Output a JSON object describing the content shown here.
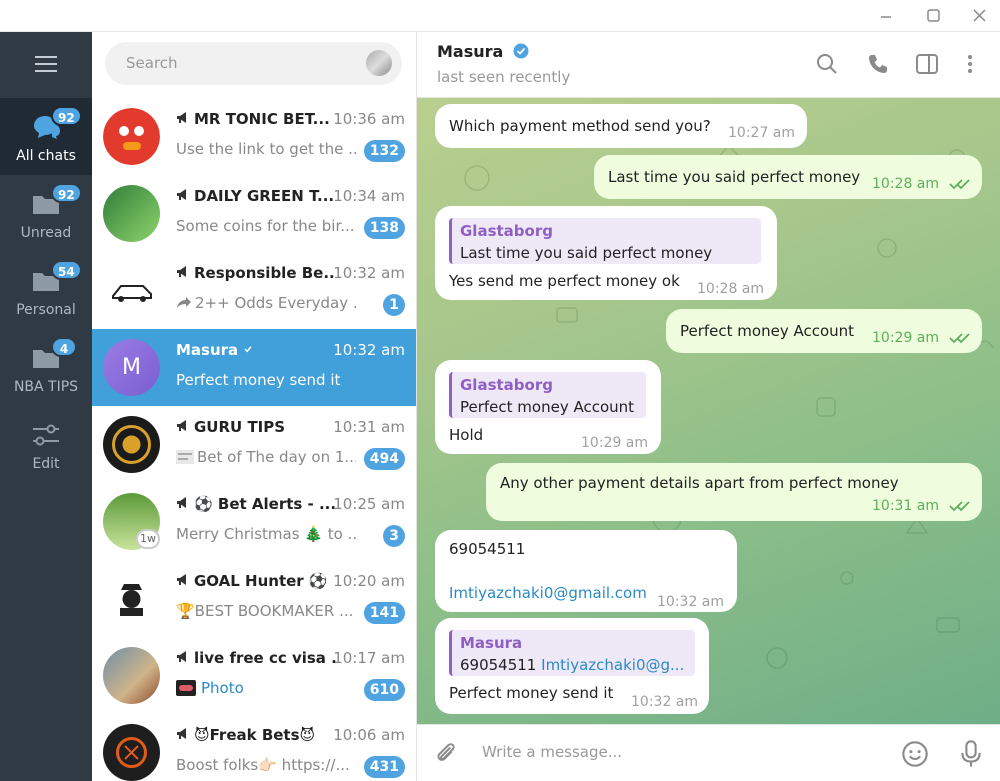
{
  "window": {
    "minimize": "—",
    "maximize": "☐",
    "close": "✕"
  },
  "folders": [
    {
      "label": "All chats",
      "badge": "92",
      "icon": "chats-icon",
      "active": true
    },
    {
      "label": "Unread",
      "badge": "92",
      "icon": "folder-icon"
    },
    {
      "label": "Personal",
      "badge": "54",
      "icon": "folder-icon"
    },
    {
      "label": "NBA TIPS",
      "badge": "4",
      "icon": "folder-icon"
    },
    {
      "label": "Edit",
      "icon": "edit-sliders-icon"
    }
  ],
  "search": {
    "placeholder": "Search"
  },
  "chats": [
    {
      "name": "MR TONIC BET...",
      "time": "10:36 am",
      "preview": "Use the link to get the ...",
      "badge": "132",
      "channel": true
    },
    {
      "name": "DAILY GREEN T...",
      "time": "10:34 am",
      "preview": "Some coins for the bir...",
      "badge": "138",
      "channel": true
    },
    {
      "name": "Responsible Be...",
      "time": "10:32 am",
      "preview": "2++ Odds  Everyday ...",
      "badge": "1",
      "channel": true
    },
    {
      "name": "Masura",
      "time": "10:32 am",
      "preview": "Perfect money send it",
      "initial": "M",
      "verified": true,
      "active": true
    },
    {
      "name": "GURU TIPS",
      "time": "10:31 am",
      "preview": "Bet of The day on 1...",
      "badge": "494",
      "channel": true
    },
    {
      "name": "⚽ Bet Alerts - ...",
      "time": "10:25 am",
      "preview": "Merry Christmas 🎄 to ...",
      "badge": "3",
      "channel": true,
      "story": "1w"
    },
    {
      "name": "GOAL Hunter ⚽",
      "time": "10:20 am",
      "preview": "🏆BEST BOOKMAKER ...",
      "badge": "141",
      "channel": true
    },
    {
      "name": "live free cc visa ...",
      "time": "10:17 am",
      "preview": "Photo",
      "badge": "610",
      "channel": true
    },
    {
      "name": "😈Freak Bets😈",
      "time": "10:06 am",
      "preview": "Boost folks👉🏻 https://...",
      "badge": "431",
      "channel": true
    }
  ],
  "header": {
    "name": "Masura",
    "status": "last seen recently"
  },
  "messages": [
    {
      "dir": "in",
      "text": "Which payment method send you?",
      "time": "10:27 am"
    },
    {
      "dir": "out",
      "text": "Last time you said perfect money",
      "time": "10:28 am"
    },
    {
      "dir": "in",
      "reply_name": "Glastaborg",
      "reply_text": "Last time you said perfect money",
      "text": "Yes send me perfect money ok",
      "time": "10:28 am"
    },
    {
      "dir": "out",
      "text": "Perfect money Account",
      "time": "10:29 am"
    },
    {
      "dir": "in",
      "reply_name": "Glastaborg",
      "reply_text": "Perfect money Account",
      "text": "Hold",
      "time": "10:29 am"
    },
    {
      "dir": "out",
      "text": "Any other payment details apart from perfect money",
      "time": "10:31 am"
    },
    {
      "dir": "in",
      "text": "69054511",
      "link": "Imtiyazchaki0@gmail.com",
      "time": "10:32 am"
    },
    {
      "dir": "in",
      "reply_name": "Masura",
      "reply_text": "69054511",
      "reply_link": "Imtiyazchaki0@g...",
      "text": "Perfect money send it",
      "time": "10:32 am"
    }
  ],
  "composer": {
    "placeholder": "Write a message..."
  },
  "colors": {
    "accent": "#419fd9",
    "rail": "#2f3a45",
    "out_bubble": "#effdde",
    "reply": "#8e5fc4"
  }
}
